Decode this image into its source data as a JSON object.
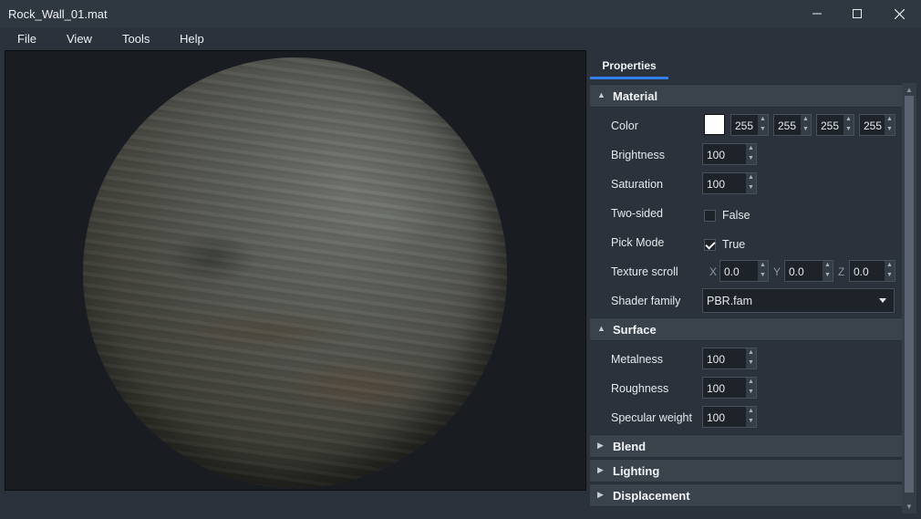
{
  "window": {
    "title": "Rock_Wall_01.mat",
    "controls": [
      "minimize",
      "maximize",
      "close"
    ]
  },
  "menu": [
    "File",
    "View",
    "Tools",
    "Help"
  ],
  "tab": {
    "label": "Properties",
    "accent": "#2f80ed"
  },
  "sections": {
    "material": {
      "label": "Material",
      "color": {
        "label": "Color",
        "swatch": "#ffffff",
        "r": "255",
        "g": "255",
        "b": "255",
        "a": "255"
      },
      "brightness": {
        "label": "Brightness",
        "value": "100"
      },
      "saturation": {
        "label": "Saturation",
        "value": "100"
      },
      "two_sided": {
        "label": "Two-sided",
        "checked": false,
        "text": "False"
      },
      "pick_mode": {
        "label": "Pick Mode",
        "checked": true,
        "text": "True"
      },
      "texture_scroll": {
        "label": "Texture scroll",
        "x_label": "X",
        "x": "0.0",
        "y_label": "Y",
        "y": "0.0",
        "z_label": "Z",
        "z": "0.0"
      },
      "shader_family": {
        "label": "Shader family",
        "value": "PBR.fam"
      }
    },
    "surface": {
      "label": "Surface",
      "metalness": {
        "label": "Metalness",
        "value": "100"
      },
      "roughness": {
        "label": "Roughness",
        "value": "100"
      },
      "specular_weight": {
        "label": "Specular weight",
        "value": "100"
      }
    },
    "blend": {
      "label": "Blend"
    },
    "lighting": {
      "label": "Lighting"
    },
    "displacement": {
      "label": "Displacement"
    }
  }
}
